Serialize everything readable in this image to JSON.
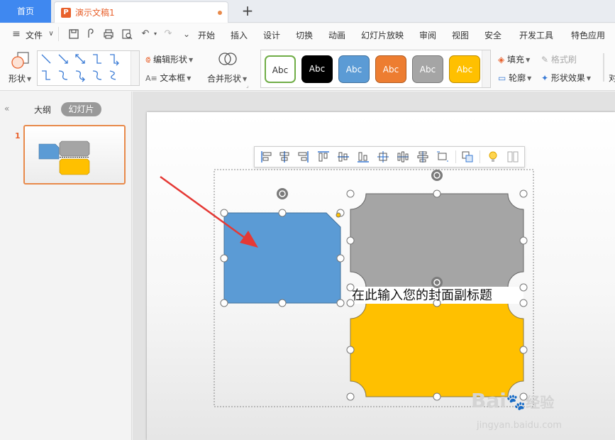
{
  "titlebar": {
    "home_tab": "首页",
    "doc_tab": "演示文稿1",
    "doc_icon_letter": "P",
    "add_tab": "+"
  },
  "menubar": {
    "file": "文件",
    "items": [
      "开始",
      "插入",
      "设计",
      "切换",
      "动画",
      "幻灯片放映",
      "审阅",
      "视图",
      "安全",
      "开发工具",
      "特色应用"
    ]
  },
  "ribbon": {
    "shapes": "形状",
    "edit_shape": "编辑形状",
    "text_box": "文本框",
    "merge_shape": "合并形状",
    "style_samples": [
      "Abc",
      "Abc",
      "Abc",
      "Abc",
      "Abc",
      "Abc"
    ],
    "style_colors": [
      "#ffffff",
      "#000000",
      "#5b9bd5",
      "#ed7d31",
      "#a5a5a5",
      "#ffc000"
    ],
    "fill": "填充",
    "format_brush": "格式刷",
    "outline": "轮廓",
    "shape_effect": "形状效果"
  },
  "leftpanel": {
    "collapse": "«",
    "outline_tab": "大纲",
    "slides_tab": "幻灯片",
    "slide_number": "1"
  },
  "slide": {
    "subtitle_placeholder": "在此输入您的封面副标题"
  },
  "colors": {
    "blue_shape": "#5b9bd5",
    "gray_shape": "#a5a5a5",
    "yellow_shape": "#ffc000",
    "arrow": "#e53935",
    "accent": "#3f88f0"
  },
  "watermark": {
    "brand": "Bai",
    "brand_cn": "经验",
    "url": "jingyan.baidu.com"
  }
}
